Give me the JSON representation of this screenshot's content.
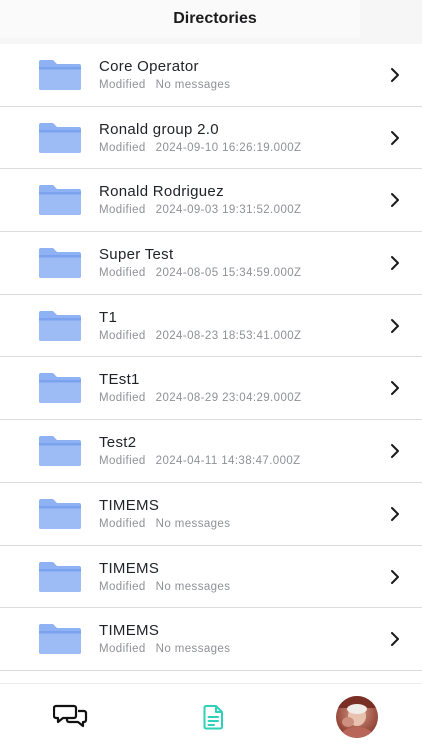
{
  "header": {
    "title": "Directories"
  },
  "directories": [
    {
      "name": "Core Operator",
      "modified_label": "Modified",
      "modified_value": "No messages"
    },
    {
      "name": "Ronald group 2.0",
      "modified_label": "Modified",
      "modified_value": "2024-09-10 16:26:19.000Z"
    },
    {
      "name": "Ronald Rodriguez",
      "modified_label": "Modified",
      "modified_value": "2024-09-03 19:31:52.000Z"
    },
    {
      "name": "Super Test",
      "modified_label": "Modified",
      "modified_value": "2024-08-05 15:34:59.000Z"
    },
    {
      "name": "T1",
      "modified_label": "Modified",
      "modified_value": "2024-08-23 18:53:41.000Z"
    },
    {
      "name": "TEst1",
      "modified_label": "Modified",
      "modified_value": "2024-08-29 23:04:29.000Z"
    },
    {
      "name": "Test2",
      "modified_label": "Modified",
      "modified_value": "2024-04-11 14:38:47.000Z"
    },
    {
      "name": "TIMEMS",
      "modified_label": "Modified",
      "modified_value": "No messages"
    },
    {
      "name": "TIMEMS",
      "modified_label": "Modified",
      "modified_value": "No messages"
    },
    {
      "name": "TIMEMS",
      "modified_label": "Modified",
      "modified_value": "No messages"
    }
  ],
  "icons": {
    "folder": "folder-icon",
    "chevron": "chevron-right-icon",
    "chat_tab": "chat-bubbles-icon",
    "docs_tab": "document-icon",
    "profile_tab": "avatar"
  },
  "colors": {
    "folder": "#8fb2f4",
    "folder_dark": "#7ba2ef",
    "active_tab": "#2fd1b8",
    "divider": "#dcdde0",
    "meta_text": "#8e9196"
  }
}
